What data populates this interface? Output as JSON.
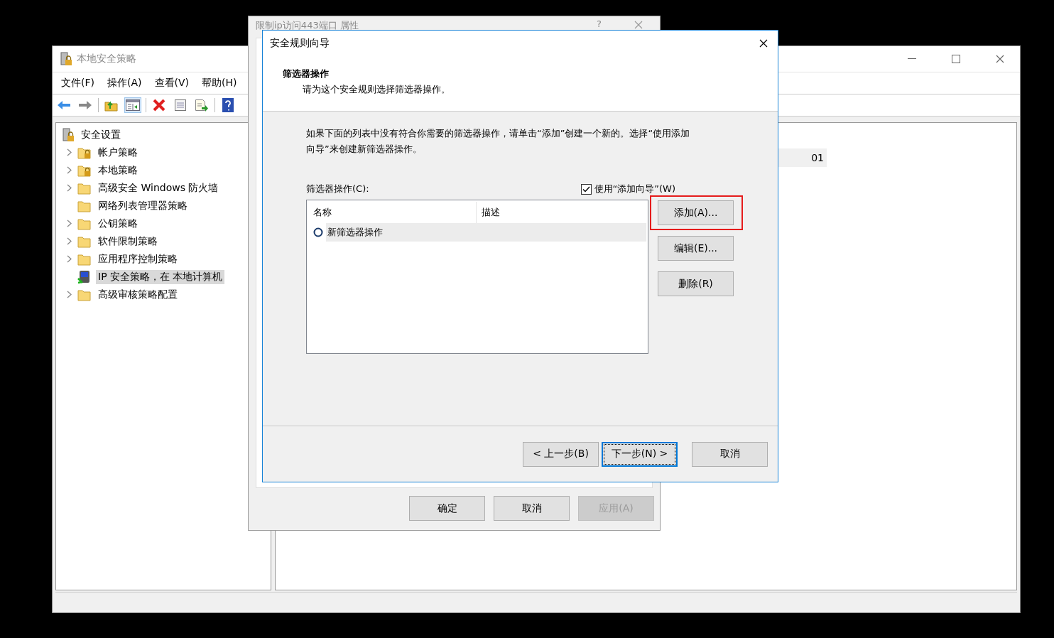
{
  "main_window": {
    "title": "本地安全策略",
    "menu": [
      "文件(F)",
      "操作(A)",
      "查看(V)",
      "帮助(H)"
    ],
    "tree": {
      "root": "安全设置",
      "children": [
        {
          "label": "帐户策略",
          "kind": "locked-folder",
          "expandable": true,
          "selected": false
        },
        {
          "label": "本地策略",
          "kind": "locked-folder",
          "expandable": true,
          "selected": false
        },
        {
          "label": "高级安全 Windows 防火墙",
          "kind": "folder",
          "expandable": true,
          "selected": false
        },
        {
          "label": "网络列表管理器策略",
          "kind": "folder",
          "expandable": false,
          "selected": false
        },
        {
          "label": "公钥策略",
          "kind": "folder",
          "expandable": true,
          "selected": false
        },
        {
          "label": "软件限制策略",
          "kind": "folder",
          "expandable": true,
          "selected": false
        },
        {
          "label": "应用程序控制策略",
          "kind": "folder",
          "expandable": true,
          "selected": false
        },
        {
          "label": "IP 安全策略，在 本地计算机",
          "kind": "computer",
          "expandable": false,
          "selected": true
        },
        {
          "label": "高级审核策略配置",
          "kind": "folder",
          "expandable": true,
          "selected": false
        }
      ]
    },
    "right_pane": {
      "cell": "01"
    }
  },
  "property_dialog": {
    "title": "限制ip访问443端口 属性",
    "help": "?",
    "buttons": [
      {
        "label": "确定",
        "disabled": false
      },
      {
        "label": "取消",
        "disabled": false
      },
      {
        "label": "应用(A)",
        "disabled": true
      }
    ]
  },
  "wizard": {
    "title": "安全规则向导",
    "header_title": "筛选器操作",
    "header_subtitle": "请为这个安全规则选择筛选器操作。",
    "description": "如果下面的列表中没有符合你需要的筛选器操作，请单击“添加”创建一个新的。选择“使用添加向导”来创建新筛选器操作。",
    "list_label": "筛选器操作(C):",
    "use_wizard": {
      "label": "使用“添加向导”(W)",
      "checked": true
    },
    "columns": [
      "名称",
      "描述"
    ],
    "rows": [
      {
        "name": "新筛选器操作",
        "selected": true
      }
    ],
    "side_buttons": [
      {
        "label": "添加(A)...",
        "highlighted": true
      },
      {
        "label": "编辑(E)...",
        "highlighted": false
      },
      {
        "label": "删除(R)",
        "highlighted": false
      }
    ],
    "nav_buttons": [
      {
        "label": "< 上一步(B)",
        "focused": false
      },
      {
        "label": "下一步(N) >",
        "focused": true
      },
      {
        "label": "取消",
        "focused": false
      }
    ]
  }
}
